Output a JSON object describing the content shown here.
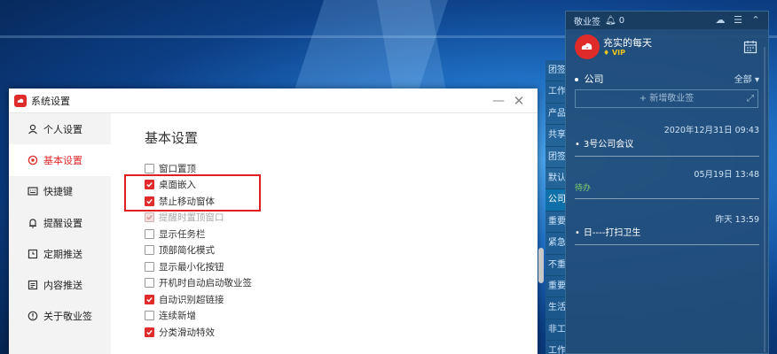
{
  "settings_window": {
    "title": "系统设置",
    "sidebar": [
      {
        "label": "个人设置",
        "icon": "user-icon"
      },
      {
        "label": "基本设置",
        "icon": "settings-circle-icon",
        "active": true
      },
      {
        "label": "快捷键",
        "icon": "keyboard-icon"
      },
      {
        "label": "提醒设置",
        "icon": "bell-icon"
      },
      {
        "label": "定期推送",
        "icon": "schedule-icon"
      },
      {
        "label": "内容推送",
        "icon": "content-icon"
      },
      {
        "label": "关于敬业签",
        "icon": "info-icon"
      }
    ],
    "section_title": "基本设置",
    "options": [
      {
        "label": "窗口置顶",
        "checked": false
      },
      {
        "label": "桌面嵌入",
        "checked": true
      },
      {
        "label": "禁止移动窗体",
        "checked": true
      },
      {
        "label": "提醒时置顶窗口",
        "checked": true,
        "disabled": true
      },
      {
        "label": "显示任务栏",
        "checked": false
      },
      {
        "label": "顶部简化模式",
        "checked": false
      },
      {
        "label": "显示最小化按钮",
        "checked": false
      },
      {
        "label": "开机时自动启动敬业签",
        "checked": false
      },
      {
        "label": "自动识别超链接",
        "checked": true
      },
      {
        "label": "连续新增",
        "checked": false
      },
      {
        "label": "分类滑动特效",
        "checked": true
      }
    ]
  },
  "vertical_tabs": [
    "团签",
    "工作",
    "产品",
    "共享",
    "团签",
    "默认",
    "公司",
    "重要",
    "紧急",
    "不重",
    "重要",
    "生活",
    "非工",
    "工作"
  ],
  "note_panel": {
    "app_name": "敬业签",
    "notification_count": "0",
    "username": "充实的每天",
    "badge": "VIP",
    "category": "公司",
    "all_label": "全部",
    "add_label": "+ 新增敬业签",
    "entries": [
      {
        "time": "2020年12月31日 09:43",
        "text": "3号公司会议",
        "tag": ""
      },
      {
        "time": "05月19日 13:48",
        "text": "",
        "tag": "待办"
      },
      {
        "time": "昨天 13:59",
        "text": "日----打扫卫生",
        "tag": ""
      }
    ]
  },
  "colors": {
    "accent": "#e02b2b",
    "panel": "#224e78"
  }
}
